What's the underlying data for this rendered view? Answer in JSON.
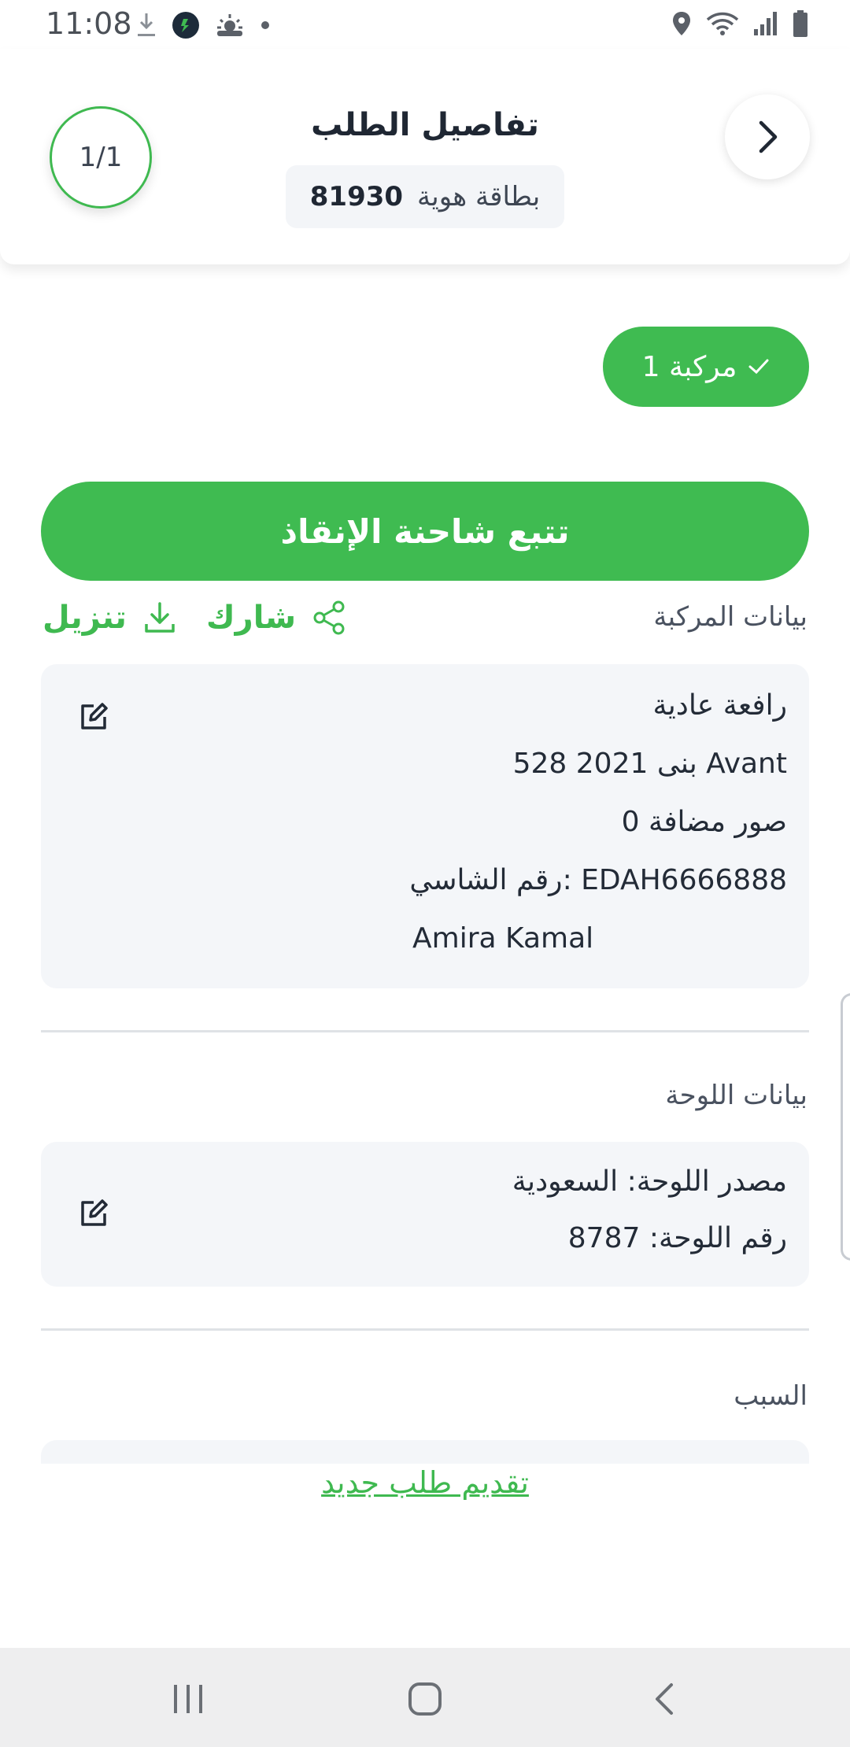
{
  "status_bar": {
    "time": "11:08"
  },
  "header": {
    "title": "تفاصيل الطلب",
    "id_label": "بطاقة هوية",
    "id_number": "81930",
    "counter": "1/1",
    "back_icon": "chevron-right-icon"
  },
  "vehicle_chip": {
    "label": "مركبة 1",
    "icon": "check-icon"
  },
  "track_button": {
    "label": "تتبع شاحنة الإنقاذ"
  },
  "vehicle_section": {
    "title": "بيانات المركبة",
    "share_label": "شارك",
    "download_label": "تنزيل",
    "card": {
      "type": "رافعة عادية",
      "model": "بنى 2021 528  Avant",
      "photos": "0 صور مضافة",
      "chassis": "رقم الشاسي: EDAH6666888",
      "owner": "Amira Kamal"
    }
  },
  "plate_section": {
    "title": "بيانات اللوحة",
    "card": {
      "source": "مصدر اللوحة: السعودية",
      "number": "رقم اللوحة: 8787"
    }
  },
  "reason_section": {
    "title": "السبب"
  },
  "new_request_link": "تقديم طلب جديد",
  "colors": {
    "accent": "#3fbb51",
    "card_bg": "#f4f6f9",
    "text": "#222a36"
  }
}
